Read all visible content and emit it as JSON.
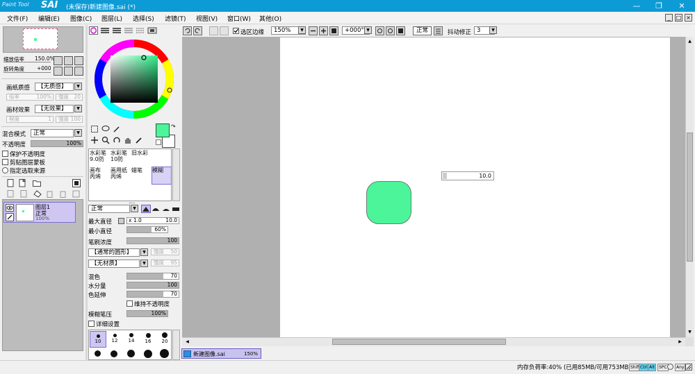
{
  "window": {
    "logo_prefix": "Paint Tool",
    "logo_name": "SAI",
    "title": "(未保存)新建图像.sai (*)"
  },
  "menu": [
    "文件(F)",
    "编辑(E)",
    "图像(C)",
    "图层(L)",
    "选择(S)",
    "滤镜(T)",
    "视图(V)",
    "窗口(W)",
    "其他(O)"
  ],
  "navigator": {
    "zoom_label": "缩放倍率",
    "zoom_value": "150.0%",
    "rotate_label": "旋转角度",
    "rotate_value": "+000"
  },
  "paper": {
    "texture_label": "画纸质感",
    "texture_value": "【无质感】",
    "rate_label": "倍率",
    "rate_value": "100%",
    "strength_label": "强度",
    "strength_value": "20",
    "effect_label": "画材效果",
    "effect_value": "【无效果】",
    "width_label": "程度",
    "width_value": "1",
    "effect_strength_label": "强度",
    "effect_strength_value": "100"
  },
  "layer_props": {
    "blend_label": "混合模式",
    "blend_value": "正常",
    "opacity_label": "不透明度",
    "opacity_value": "100%",
    "opacity_level": 1.0,
    "protect_opacity": "保护不透明度",
    "clip_group": "剪贴图层蒙板",
    "selection_source": "指定选取来源"
  },
  "layers": [
    {
      "name": "图层1",
      "mode": "正常",
      "opacity": "100%"
    }
  ],
  "color": {
    "primary": "#4cf59a",
    "secondary": "#ffffff"
  },
  "tools": [
    {
      "label1": "水彩笔",
      "label2": "9.0防"
    },
    {
      "label1": "水彩笔",
      "label2": "10防"
    },
    {
      "label1": "旧水彩",
      "label2": ""
    },
    {
      "label1": "",
      "label2": ""
    },
    {
      "label1": "画布",
      "label2": "丙烯"
    },
    {
      "label1": "画用纸",
      "label2": "丙烯"
    },
    {
      "label1": "蜡笔",
      "label2": ""
    },
    {
      "label1": "模糊",
      "label2": ""
    }
  ],
  "brush": {
    "mode_value": "正常",
    "max_diameter_label": "最大直径",
    "max_diameter_mult": "x 1.0",
    "max_diameter_value": "10.0",
    "min_diameter_label": "最小直径",
    "min_diameter_value": "60%",
    "min_diameter_level": 0.6,
    "density_label": "笔刷浓度",
    "density_value": "100",
    "density_level": 1.0,
    "shape_value": "【通常的圆形】",
    "shape_strength_value": "50",
    "texture_value": "【无材质】",
    "texture_strength_value": "95",
    "blend_label": "混色",
    "blend_value": "70",
    "water_label": "水分量",
    "water_value": "100",
    "extend_label": "色延伸",
    "extend_value": "70",
    "keep_opacity": "维持不透明度",
    "blur_pressure_label": "模糊笔压",
    "blur_pressure_value": "100%",
    "detail": "详细设置",
    "sizes": [
      "10",
      "12",
      "14",
      "16",
      "20"
    ]
  },
  "toolbar": {
    "selection_edge": "选区边缘",
    "zoom_value": "150%",
    "angle_value": "+000°",
    "mode_value": "正常",
    "stabilizer_label": "抖动修正",
    "stabilizer_value": "3"
  },
  "canvas_tooltip": "10.0",
  "tab": {
    "name": "新建图像.sai",
    "zoom": "150%"
  },
  "status": {
    "memory": "内存负荷率:40% (已用85MB/可用753MB)",
    "keys": [
      "Shift",
      "Ctrl",
      "Alt",
      "SPC",
      "Any"
    ]
  }
}
